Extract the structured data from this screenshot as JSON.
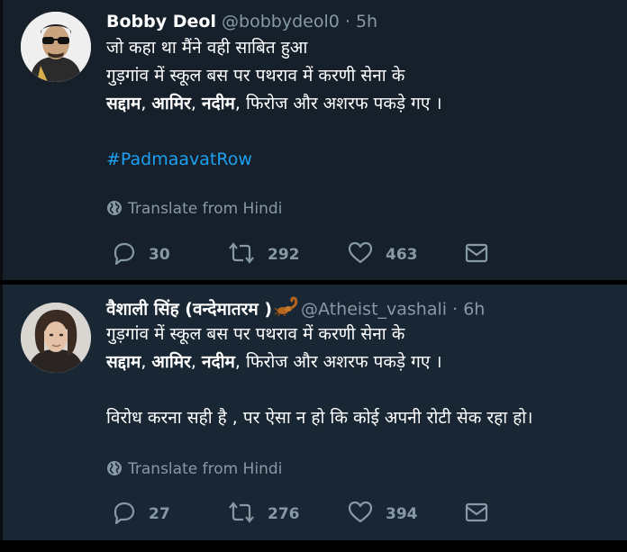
{
  "tweets": [
    {
      "name": "Bobby Deol",
      "handle": "@bobbydeol0",
      "separator": "·",
      "time": "5h",
      "text_lines": {
        "l1": "जो कहा था मैंने वही साबित हुआ",
        "l2": "गुड़गांव में स्कूल बस पर पथराव में करणी सेना के",
        "l3_a": "सद्दाम",
        "l3_b": ", ",
        "l3_c": "आमिर",
        "l3_d": ", ",
        "l3_e": "नदीम",
        "l3_f": ", फिरोज और अशरफ पकड़े गए ।",
        "hashtag": "#PadmaavatRow"
      },
      "translate": "Translate from Hindi",
      "replies": "30",
      "retweets": "292",
      "likes": "463"
    },
    {
      "name": "वैशाली सिंह (वन्देमातरम )",
      "handle": "@Atheist_vashali",
      "separator": "·",
      "time": "6h",
      "text_lines": {
        "l1": "गुड़गांव में स्कूल बस पर पथराव में करणी सेना के",
        "l2_a": "सद्दाम",
        "l2_b": ", ",
        "l2_c": "आमिर",
        "l2_d": ", ",
        "l2_e": "नदीम",
        "l2_f": ", फिरोज और अशरफ पकड़े गए ।",
        "l4": "विरोध करना सही है , पर ऐसा न हो कि कोई अपनी रोटी सेक रहा हो।"
      },
      "translate": "Translate from Hindi",
      "replies": "27",
      "retweets": "276",
      "likes": "394"
    }
  ],
  "icons": {
    "reply": "reply-icon",
    "retweet": "retweet-icon",
    "like": "heart-icon",
    "dm": "envelope-icon",
    "globe": "globe-icon",
    "scorpion": "scorpion-emoji-icon"
  },
  "colors": {
    "background": "#15202b",
    "text": "#ffffff",
    "muted": "#8899a6",
    "link": "#1da1f2"
  }
}
